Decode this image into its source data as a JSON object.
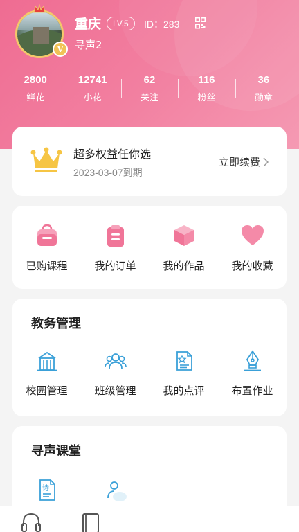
{
  "profile": {
    "name": "重庆",
    "level": "LV.5",
    "id_text": "ID：283",
    "subtitle": "寻声2",
    "badge": "V"
  },
  "stats": [
    {
      "value": "2800",
      "label": "鲜花"
    },
    {
      "value": "12741",
      "label": "小花"
    },
    {
      "value": "62",
      "label": "关注"
    },
    {
      "value": "116",
      "label": "粉丝"
    },
    {
      "value": "36",
      "label": "勋章"
    }
  ],
  "vip": {
    "title": "超多权益任你选",
    "expire": "2023-03-07到期",
    "renew_label": "立即续费"
  },
  "quick": [
    {
      "label": "已购课程",
      "icon": "bag-icon"
    },
    {
      "label": "我的订单",
      "icon": "clipboard-icon"
    },
    {
      "label": "我的作品",
      "icon": "cube-icon"
    },
    {
      "label": "我的收藏",
      "icon": "heart-icon"
    }
  ],
  "academic": {
    "title": "教务管理",
    "items": [
      {
        "label": "校园管理",
        "icon": "building-icon"
      },
      {
        "label": "班级管理",
        "icon": "group-icon"
      },
      {
        "label": "我的点评",
        "icon": "comment-doc-icon"
      },
      {
        "label": "布置作业",
        "icon": "pen-nib-icon"
      }
    ]
  },
  "classroom": {
    "title": "寻声课堂",
    "items": [
      {
        "label": "诗",
        "icon": "poem-doc-icon"
      },
      {
        "icon": "person-icon"
      }
    ]
  },
  "bottom_nav": [
    {
      "icon": "headphones-icon"
    },
    {
      "icon": "book-icon"
    }
  ],
  "colors": {
    "brand_pink": "#ef6c92",
    "icon_pink": "#f07598",
    "icon_blue": "#3aa0d8",
    "gold": "#f3c24b"
  }
}
